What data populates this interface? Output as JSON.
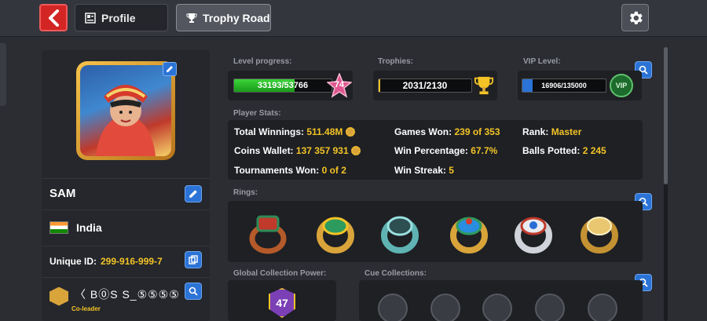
{
  "header": {
    "tabs": [
      {
        "label": "Profile"
      },
      {
        "label": "Trophy Road"
      }
    ]
  },
  "profile": {
    "name": "SAM",
    "country": "India",
    "unique_id_label": "Unique ID:",
    "unique_id": "299-916-999-7",
    "club_name": "〈 B⓪S S_⑤⑤⑤⑤",
    "club_role": "Co-leader"
  },
  "level": {
    "label": "Level progress:",
    "progress_text": "33193/53766",
    "progress_fraction": 0.617,
    "level": "74"
  },
  "trophies": {
    "label": "Trophies:",
    "value": "2031/2130"
  },
  "vip": {
    "label": "VIP Level:",
    "value": "16906/135000",
    "badge": "VIP"
  },
  "stats": {
    "label": "Player Stats:",
    "total_winnings_label": "Total Winnings:",
    "total_winnings": "511.48M",
    "coins_wallet_label": "Coins Wallet:",
    "coins_wallet": "137 357 931",
    "tournaments_won_label": "Tournaments Won:",
    "tournaments_won": "0 of 2",
    "games_won_label": "Games Won:",
    "games_won": "239 of 353",
    "win_percentage_label": "Win Percentage:",
    "win_percentage": "67.7%",
    "win_streak_label": "Win Streak:",
    "win_streak": "5",
    "rank_label": "Rank:",
    "rank": "Master",
    "balls_potted_label": "Balls Potted:",
    "balls_potted": "2 245"
  },
  "rings": {
    "label": "Rings:",
    "items": [
      {
        "name": "red-green-ring",
        "color": "#c0392b"
      },
      {
        "name": "gold-green-ring",
        "color": "#2e9b5e"
      },
      {
        "name": "silver-teal-ring",
        "color": "#5fb3b3"
      },
      {
        "name": "blue-gold-ring",
        "color": "#2a8de0"
      },
      {
        "name": "silver-red-ring",
        "color": "#d0d4da"
      },
      {
        "name": "gold-ring",
        "color": "#d9a43a"
      }
    ]
  },
  "collection": {
    "label": "Global Collection Power:",
    "value": "47",
    "cue_label": "Cue Collections:"
  },
  "colors": {
    "accent_yellow": "#f3c326",
    "button_blue": "#2b73d6",
    "back_red": "#d42525"
  }
}
